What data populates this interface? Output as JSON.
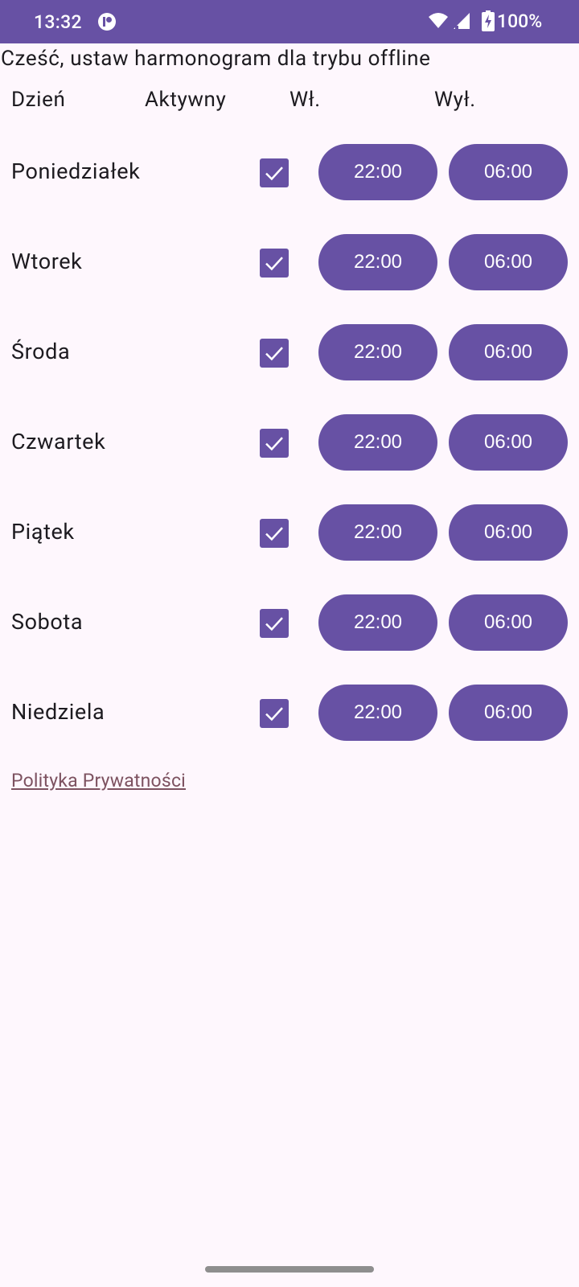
{
  "status_bar": {
    "time": "13:32",
    "battery": "100%",
    "icons": [
      "app-notification-icon",
      "wifi-icon",
      "signal-icon",
      "battery-charging-icon"
    ]
  },
  "greeting": "Cześć, ustaw harmonogram dla trybu offline",
  "headers": {
    "day": "Dzień",
    "active": "Aktywny",
    "on": "Wł.",
    "off": "Wył."
  },
  "schedule": [
    {
      "day": "Poniedziałek",
      "active": true,
      "on": "22:00",
      "off": "06:00"
    },
    {
      "day": "Wtorek",
      "active": true,
      "on": "22:00",
      "off": "06:00"
    },
    {
      "day": "Środa",
      "active": true,
      "on": "22:00",
      "off": "06:00"
    },
    {
      "day": "Czwartek",
      "active": true,
      "on": "22:00",
      "off": "06:00"
    },
    {
      "day": "Piątek",
      "active": true,
      "on": "22:00",
      "off": "06:00"
    },
    {
      "day": "Sobota",
      "active": true,
      "on": "22:00",
      "off": "06:00"
    },
    {
      "day": "Niedziela",
      "active": true,
      "on": "22:00",
      "off": "06:00"
    }
  ],
  "privacy_link": "Polityka Prywatności",
  "colors": {
    "accent": "#6751a4",
    "background": "#fef7fd",
    "link": "#7d5260"
  }
}
